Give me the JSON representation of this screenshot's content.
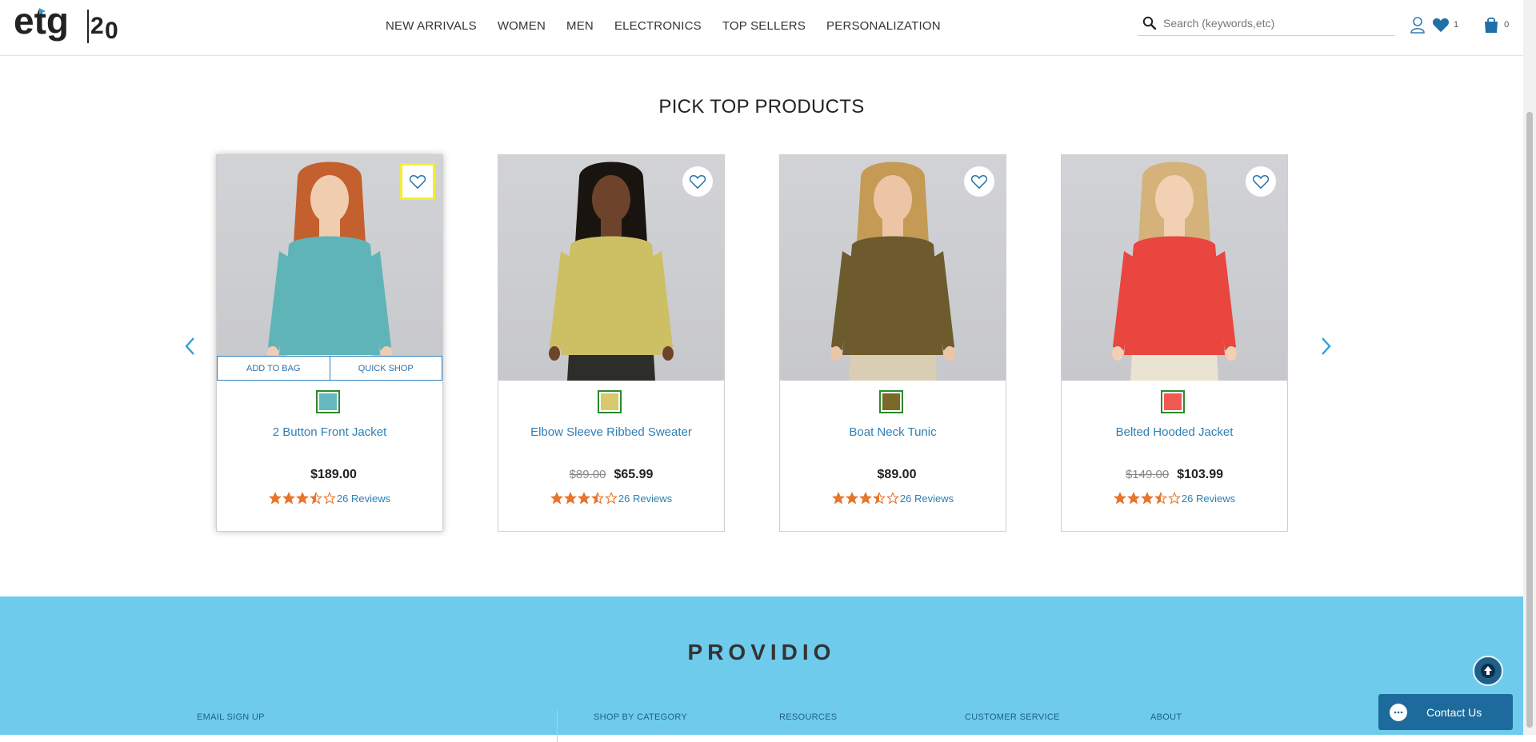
{
  "header": {
    "logo_text": "etg20",
    "nav": [
      "NEW ARRIVALS",
      "WOMEN",
      "MEN",
      "ELECTRONICS",
      "TOP SELLERS",
      "PERSONALIZATION"
    ],
    "search_placeholder": "Search (keywords,etc)",
    "wishlist_count": "1",
    "cart_count": "0"
  },
  "section": {
    "title": "PICK TOP PRODUCTS"
  },
  "card_actions": {
    "add_to_bag": "ADD TO BAG",
    "quick_shop": "QUICK SHOP"
  },
  "products": [
    {
      "name": "2 Button Front Jacket",
      "old_price": "",
      "price": "$189.00",
      "reviews": "26 Reviews",
      "rating": 3.5,
      "swatch_color": "#66b9bf",
      "garment_color": "#5fb4b8",
      "skin": "#f1cdb0",
      "hair": "#c3602e",
      "pants": "#f1f1ea"
    },
    {
      "name": "Elbow Sleeve Ribbed Sweater",
      "old_price": "$89.00",
      "price": "$65.99",
      "reviews": "26 Reviews",
      "rating": 3.5,
      "swatch_color": "#d8c86e",
      "garment_color": "#cdbf64",
      "skin": "#6e432b",
      "hair": "#1a1410",
      "pants": "#2d2e2a"
    },
    {
      "name": "Boat Neck Tunic",
      "old_price": "",
      "price": "$89.00",
      "reviews": "26 Reviews",
      "rating": 3.5,
      "swatch_color": "#7a6a2a",
      "garment_color": "#6d5b2e",
      "skin": "#ecc6a4",
      "hair": "#c49a55",
      "pants": "#d9cdb3"
    },
    {
      "name": "Belted Hooded Jacket",
      "old_price": "$149.00",
      "price": "$103.99",
      "reviews": "26 Reviews",
      "rating": 3.5,
      "swatch_color": "#f15a52",
      "garment_color": "#e8463e",
      "skin": "#f2d0b4",
      "hair": "#d4b27a",
      "pants": "#ebe3d2"
    }
  ],
  "footer": {
    "brand": "PROVIDIO",
    "columns": [
      "EMAIL SIGN UP",
      "SHOP BY CATEGORY",
      "RESOURCES",
      "CUSTOMER SERVICE",
      "ABOUT"
    ]
  },
  "contact_label": "Contact Us",
  "colors": {
    "accent": "#2f7fb5",
    "star": "#e8742b",
    "footer_bg": "#6ecbec"
  }
}
